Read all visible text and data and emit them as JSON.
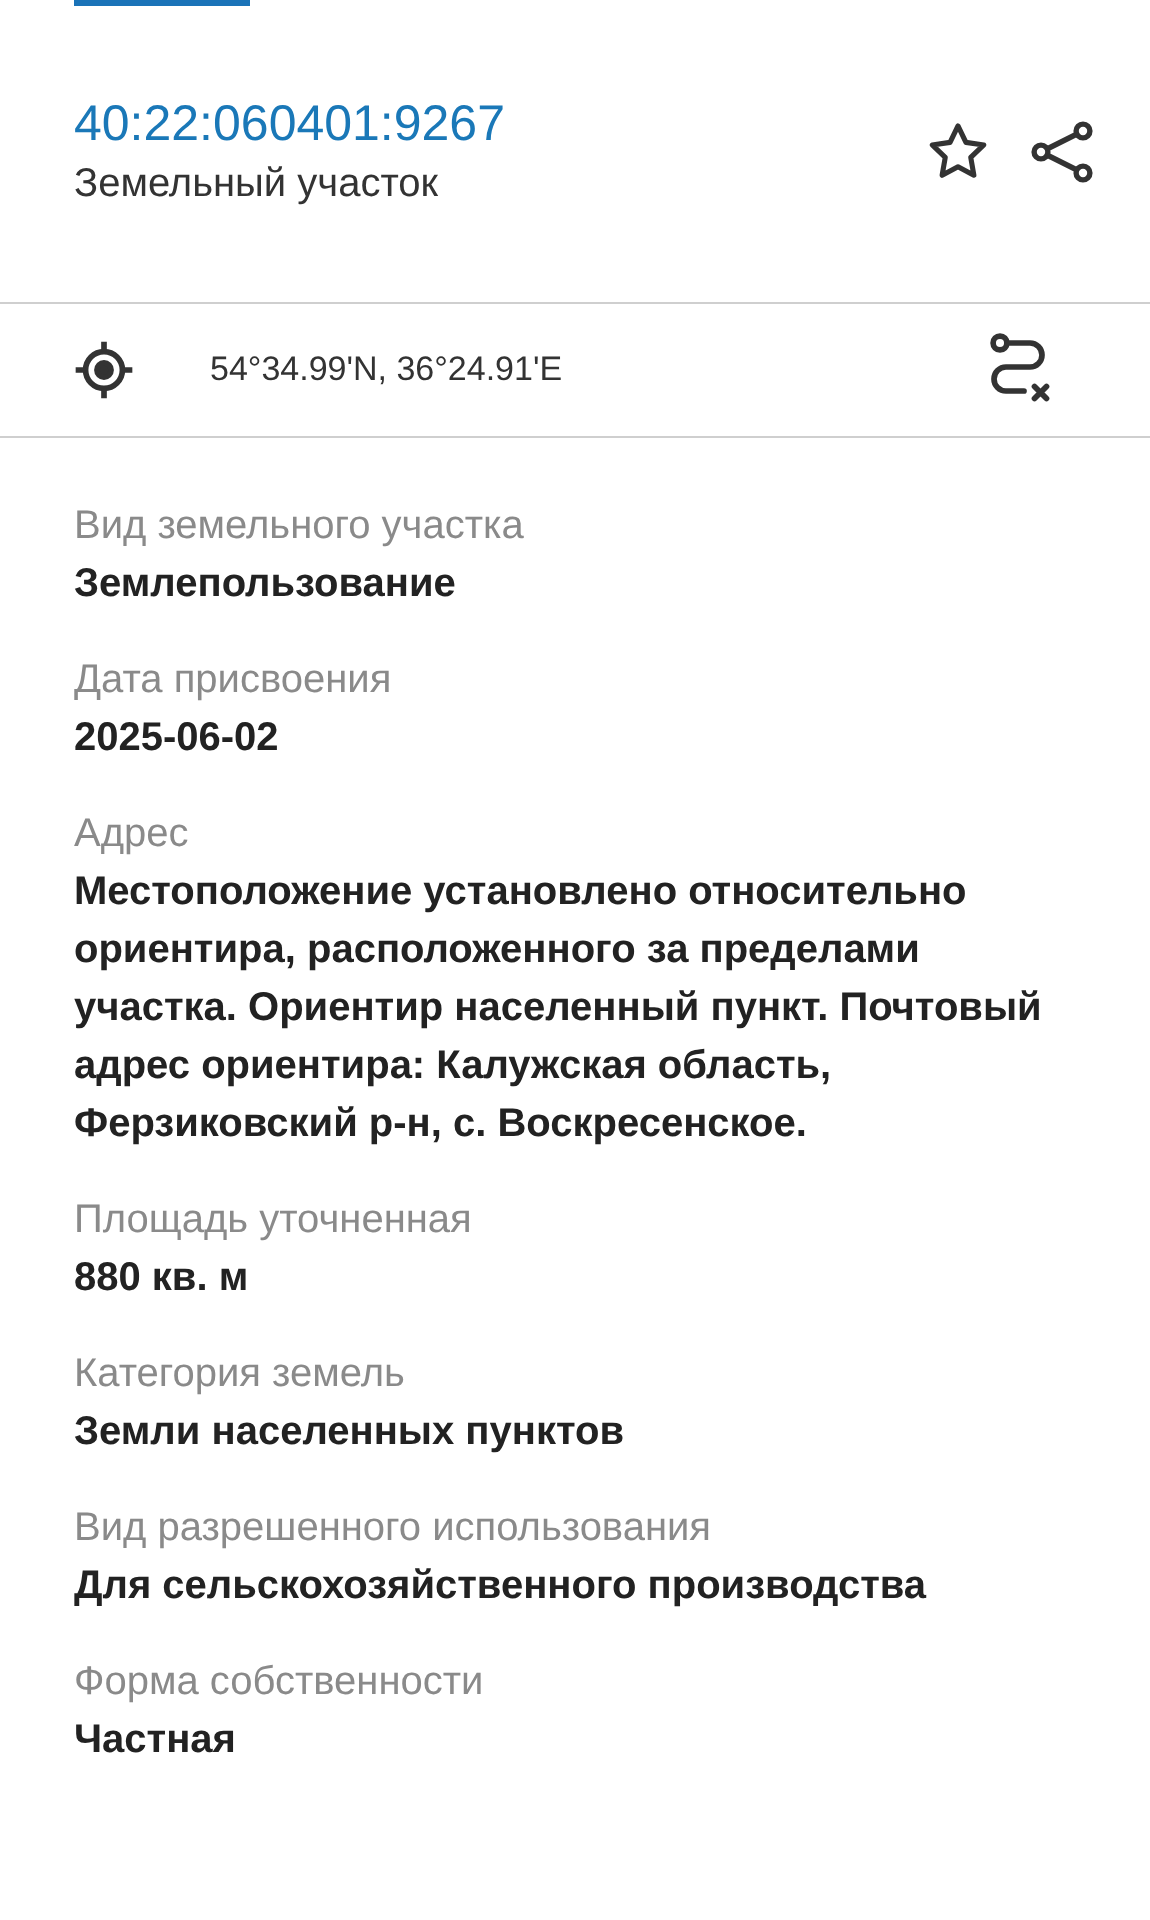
{
  "header": {
    "cadastral_number": "40:22:060401:9267",
    "object_type": "Земельный участок"
  },
  "location": {
    "coordinates": "54°34.99'N, 36°24.91'E"
  },
  "fields": [
    {
      "label": "Вид земельного участка",
      "value": "Землепользование"
    },
    {
      "label": "Дата присвоения",
      "value": "2025-06-02"
    },
    {
      "label": "Адрес",
      "value": "Местоположение установлено относительно ориентира, расположенного за пределами участка. Ориентир населенный пункт. Почтовый адрес ориентира: Калужская область, Ферзиковский р-н, с. Воскресенское."
    },
    {
      "label": "Площадь уточненная",
      "value": "880 кв. м"
    },
    {
      "label": "Категория земель",
      "value": "Земли населенных пунктов"
    },
    {
      "label": "Вид разрешенного использования",
      "value": "Для сельскохозяйственного производства"
    },
    {
      "label": "Форма собственности",
      "value": "Частная"
    }
  ]
}
